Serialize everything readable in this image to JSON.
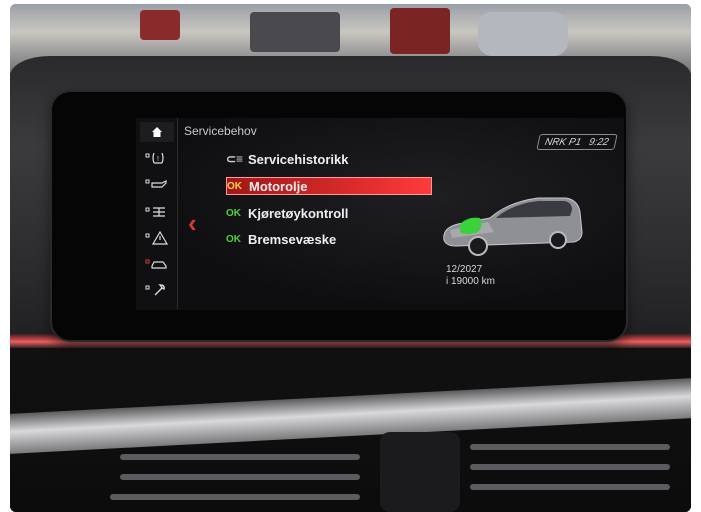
{
  "screen": {
    "title": "Servicebehov",
    "status": {
      "radio": "NRK P1",
      "time": "9:22"
    },
    "rail_icons": [
      "home-icon",
      "tire-pressure-icon",
      "oil-can-icon",
      "transmission-icon",
      "warning-triangle-icon",
      "car-service-icon",
      "wrench-icon"
    ],
    "menu": [
      {
        "ok": "",
        "label": "Servicehistorikk",
        "selected": false
      },
      {
        "ok": "OK",
        "label": "Motorolje",
        "selected": true
      },
      {
        "ok": "OK",
        "label": "Kjøretøykontroll",
        "selected": false
      },
      {
        "ok": "OK",
        "label": "Bremsevæske",
        "selected": false
      }
    ],
    "service_due": {
      "date": "12/2027",
      "distance": "i 19000 km"
    },
    "colors": {
      "accent_red": "#d92a2a",
      "ok_green": "#4cd43a",
      "engine_highlight": "#3bd13b"
    }
  }
}
